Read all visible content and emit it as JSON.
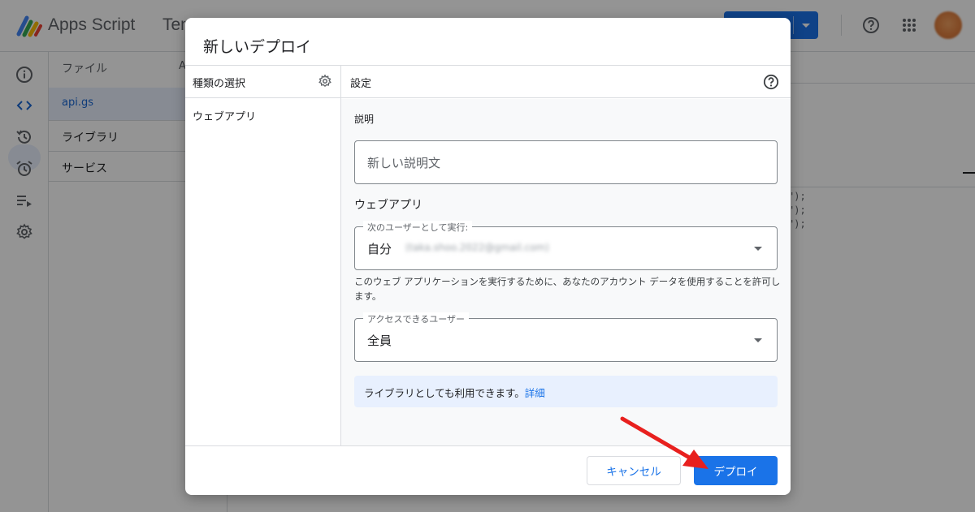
{
  "app": {
    "title": "Apps Script",
    "project_title": "Ten"
  },
  "files_panel": {
    "header": "ファイル",
    "sort_hint": "A",
    "file": "api.gs",
    "sections": [
      "ライブラリ",
      "サービス"
    ]
  },
  "editor": {
    "code_lines": [
      "\");",
      "\");",
      "\");"
    ]
  },
  "dialog": {
    "title": "新しいデプロイ",
    "left_header": "種類の選択",
    "type_item": "ウェブアプリ",
    "right_header": "設定",
    "description_label": "説明",
    "description_placeholder": "新しい説明文",
    "webapp_title": "ウェブアプリ",
    "execute_as_label": "次のユーザーとして実行:",
    "execute_as_value": "自分",
    "execute_as_email": "(taka.shoo.2022@gmail.com)",
    "hint": "このウェブ アプリケーションを実行するために、あなたのアカウント データを使用することを許可します。",
    "access_label": "アクセスできるユーザー",
    "access_value": "全員",
    "info_text": "ライブラリとしても利用できます。",
    "info_link": "詳細",
    "cancel_label": "キャンセル",
    "deploy_label": "デプロイ"
  },
  "colors": {
    "accent": "#1a73e8",
    "arrow": "#e8201e",
    "info_bg": "#e8f0fe"
  },
  "icons": [
    "info-icon",
    "code-icon",
    "history-icon",
    "alarm-icon",
    "executions-icon",
    "gear-icon",
    "help-icon",
    "apps-icon",
    "dropdown-arrow-icon"
  ]
}
